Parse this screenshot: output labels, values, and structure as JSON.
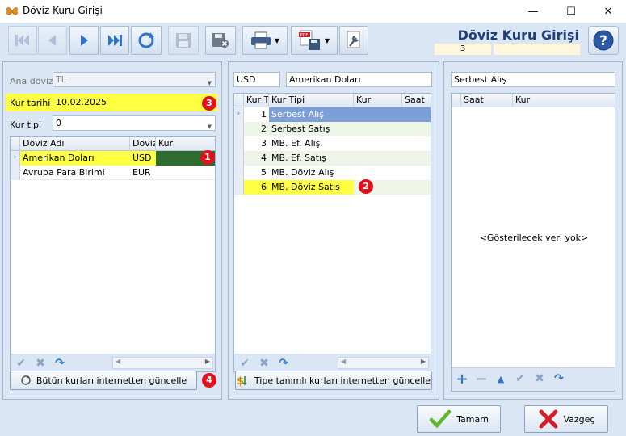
{
  "window": {
    "title": "Döviz Kuru Girişi",
    "minimize": "—",
    "maximize": "☐",
    "close": "✕"
  },
  "toolbar": {
    "heading": "Döviz Kuru Girişi",
    "record_no": "3",
    "buttons": [
      "first-record",
      "previous-record",
      "next-record",
      "last-record",
      "refresh",
      "save",
      "cancel-save",
      "print",
      "export",
      "settings"
    ],
    "help": "?"
  },
  "left": {
    "ana_doviz_label": "Ana döviz",
    "ana_doviz_value": "TL",
    "kur_tarihi_label": "Kur tarihi",
    "kur_tarihi_value": "10.02.2025",
    "kur_tipi_label": "Kur tipi",
    "kur_tipi_value": "0",
    "columns": [
      "Döviz Adı",
      "Döviz",
      "Kur"
    ],
    "rows": [
      {
        "name": "Amerikan Doları",
        "code": "USD",
        "rate": ""
      },
      {
        "name": "Avrupa Para Birimi",
        "code": "EUR",
        "rate": ""
      }
    ],
    "update_button": "Bütün kurları internetten güncelle"
  },
  "middle": {
    "code": "USD",
    "name": "Amerikan Doları",
    "columns": [
      "Kur T",
      "Kur Tipi",
      "Kur",
      "Saat"
    ],
    "rows": [
      {
        "no": "1",
        "type": "Serbest Alış",
        "rate": "",
        "time": ""
      },
      {
        "no": "2",
        "type": "Serbest Satış",
        "rate": "",
        "time": ""
      },
      {
        "no": "3",
        "type": "MB. Ef. Alış",
        "rate": "",
        "time": ""
      },
      {
        "no": "4",
        "type": "MB. Ef. Satış",
        "rate": "",
        "time": ""
      },
      {
        "no": "5",
        "type": "MB. Döviz Alış",
        "rate": "",
        "time": ""
      },
      {
        "no": "6",
        "type": "MB. Döviz Satış",
        "rate": "",
        "time": ""
      }
    ],
    "update_button": "Tipe tanımlı kurları internetten güncelle"
  },
  "right": {
    "selected_type": "Serbest Alış",
    "columns": [
      "Saat",
      "Kur"
    ],
    "empty_text": "<Gösterilecek veri yok>"
  },
  "footer": {
    "ok": "Tamam",
    "cancel": "Vazgeç"
  },
  "badges": [
    "1",
    "2",
    "3",
    "4"
  ],
  "colors": {
    "highlight": "#ffff44",
    "selected_blue": "#7c9fd8",
    "selected_green": "#2e6b2e",
    "badge": "#e0121c"
  }
}
